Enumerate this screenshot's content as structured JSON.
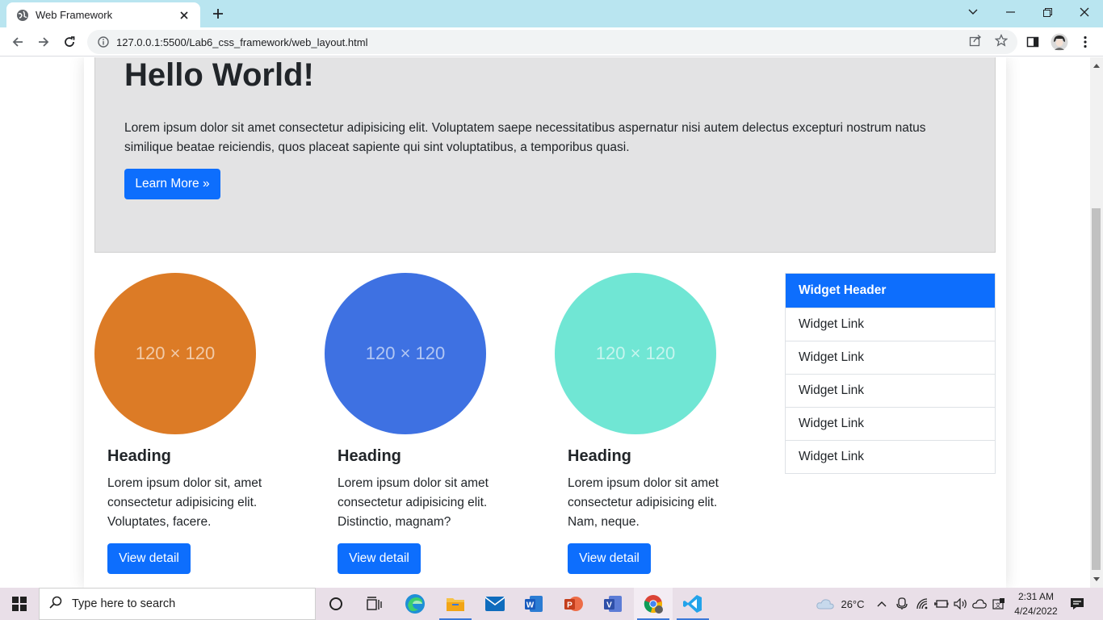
{
  "browser": {
    "tab_title": "Web Framework",
    "url": "127.0.0.1:5500/Lab6_css_framework/web_layout.html"
  },
  "jumbotron": {
    "title": "Hello World!",
    "text": "Lorem ipsum dolor sit amet consectetur adipisicing elit. Voluptatem saepe necessitatibus aspernatur nisi autem delectus excepturi nostrum natus similique beatae reiciendis, quos placeat sapiente qui sint voluptatibus, a temporibus quasi.",
    "button_label": "Learn More »"
  },
  "cards": [
    {
      "placeholder": "120 × 120",
      "color": "#dc7b26",
      "heading": "Heading",
      "text": "Lorem ipsum dolor sit, amet consectetur adipisicing elit. Voluptates, facere.",
      "button_label": "View detail"
    },
    {
      "placeholder": "120 × 120",
      "color": "#3e71e2",
      "heading": "Heading",
      "text": "Lorem ipsum dolor sit amet consectetur adipisicing elit. Distinctio, magnam?",
      "button_label": "View detail"
    },
    {
      "placeholder": "120 × 120",
      "color": "#70e6d4",
      "heading": "Heading",
      "text": "Lorem ipsum dolor sit amet consectetur adipisicing elit. Nam, neque.",
      "button_label": "View detail"
    }
  ],
  "widget": {
    "header": "Widget Header",
    "links": [
      "Widget Link",
      "Widget Link",
      "Widget Link",
      "Widget Link",
      "Widget Link"
    ]
  },
  "taskbar": {
    "search_placeholder": "Type here to search",
    "temperature": "26°C",
    "time": "2:31 AM",
    "date": "4/24/2022"
  },
  "colors": {
    "primary": "#0d6efd",
    "tabbar": "#b9e5f0",
    "jumbotron_bg": "#e3e3e4"
  }
}
